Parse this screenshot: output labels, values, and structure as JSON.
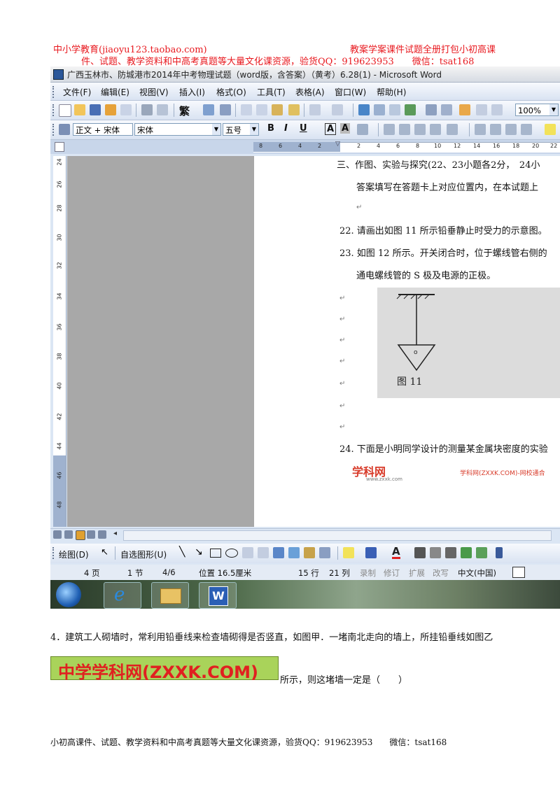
{
  "header": {
    "left": "中小学教育(jiaoyu123.taobao.com)",
    "right": "教案学案课件试题全册打包小初高课",
    "line2": "件、试题、教学资料和中高考真题等大量文化课资源，验货QQ：919623953　　微信：tsat168"
  },
  "window": {
    "title": "广西玉林市、防城港市2014年中考物理试题（word版，含答案）（黄考）6.28(1) - Microsoft Word",
    "menu": [
      "文件(F)",
      "编辑(E)",
      "视图(V)",
      "插入(I)",
      "格式(O)",
      "工具(T)",
      "表格(A)",
      "窗口(W)",
      "帮助(H)"
    ],
    "toolbar": {
      "trad": "繁",
      "zoom": "100%"
    },
    "format": {
      "style": "正文 + 宋体",
      "font": "宋体",
      "size": "五号",
      "bold": "B",
      "italic": "I",
      "underline": "U",
      "a1": "A",
      "a2": "A"
    },
    "ruler_numbers": [
      "8",
      "6",
      "4",
      "2",
      "2",
      "4",
      "6",
      "8",
      "10",
      "12",
      "14",
      "16",
      "18",
      "20",
      "22"
    ],
    "vruler_numbers": [
      "24",
      "26",
      "28",
      "30",
      "32",
      "34",
      "36",
      "38",
      "40",
      "42",
      "44",
      "46",
      "48"
    ],
    "doc": {
      "line1": "三、作图、实验与探究(22、23小题各2分，　24小",
      "line2": "答案填写在答题卡上对应位置内，在本试题上",
      "q22": "22. 请画出如图 11 所示铅垂静止时受力的示意图。",
      "q23a": "23. 如图 12 所示。开关闭合时，位于螺线管右侧的",
      "q23b": "通电螺线管的 S 极及电源的正极。",
      "fig_label": "图 11",
      "fig_o": "o",
      "q24": "24. 下面是小明同学设计的测量某金属块密度的实验",
      "para": "↵",
      "wm_left": "学科网",
      "wm_left_url": "www.zxxk.com",
      "wm_right": "学科网(ZXXK.COM)-网校通合"
    },
    "drawing": {
      "draw": "绘图(D)",
      "autoshape": "自选图形(U)"
    },
    "status": {
      "page": "4 页",
      "sec": "1 节",
      "pos": "4/6",
      "at": "位置 16.5厘米",
      "ln": "15 行",
      "col": "21 列",
      "rec": "录制",
      "trk": "修订",
      "ext": "扩展",
      "ovr": "改写",
      "lang": "中文(中国)"
    }
  },
  "question4": {
    "text": "4．建筑工人砌墙时，常利用铅垂线来检查墙砌得是否竖直，如图甲．一堵南北走向的墙上，所挂铅垂线如图乙",
    "logo": "中学学科网(ZXXK.COM)",
    "tail": "所示，则这堵墙一定是（　　）"
  },
  "footer": "小初高课件、试题、教学资料和中高考真题等大量文化课资源，验货QQ：919623953　　微信：tsat168"
}
